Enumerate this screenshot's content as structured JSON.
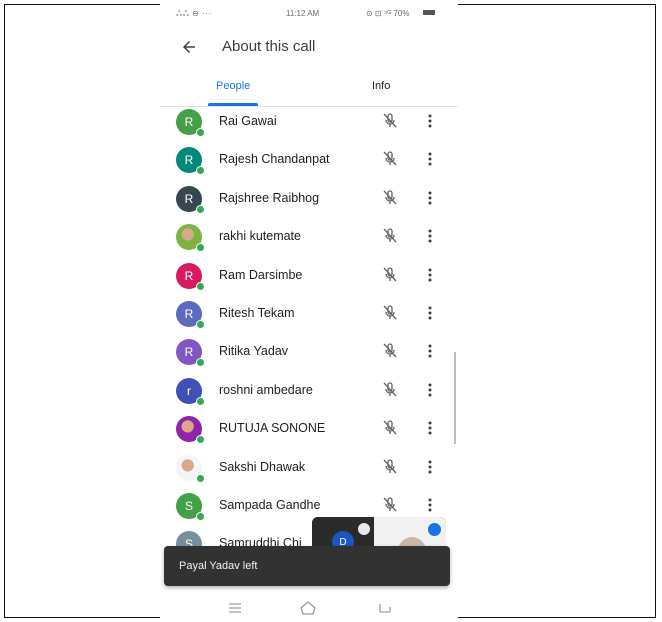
{
  "status_bar": {
    "left_icons": "ஃஃ ⊖ ···",
    "time": "11:12 AM",
    "right_icons": "⊙ ⊡ ⁴ᴳ 70%"
  },
  "appbar": {
    "title": "About this call",
    "back_icon": "arrow-back-icon"
  },
  "tabs": [
    {
      "label": "People",
      "selected": true
    },
    {
      "label": "Info",
      "selected": false
    }
  ],
  "participants": [
    {
      "name": "Rai Gawai",
      "initial": "R",
      "color": "#43a047"
    },
    {
      "name": "Rajesh Chandanpat",
      "initial": "R",
      "color": "#00897b"
    },
    {
      "name": "Rajshree Raibhog",
      "initial": "R",
      "color": "#37474f"
    },
    {
      "name": "rakhi kutemate",
      "initial": "",
      "color": "#7cb342",
      "photo": true
    },
    {
      "name": "Ram Darsimbe",
      "initial": "R",
      "color": "#d81b60"
    },
    {
      "name": "Ritesh Tekam",
      "initial": "R",
      "color": "#5c6bc0"
    },
    {
      "name": "Ritika Yadav",
      "initial": "R",
      "color": "#7e57c2"
    },
    {
      "name": "roshni ambedare",
      "initial": "r",
      "color": "#3f51b5"
    },
    {
      "name": "RUTUJA SONONE",
      "initial": "",
      "color": "#8e24aa",
      "photo": true
    },
    {
      "name": "Sakshi Dhawak",
      "initial": "",
      "color": "#f5f5f5",
      "photo": true
    },
    {
      "name": "Sampada Gandhe",
      "initial": "S",
      "color": "#43a047"
    },
    {
      "name": "Samruddhi Chi",
      "initial": "S",
      "color": "#78909c"
    }
  ],
  "pip": {
    "self_initial": "D"
  },
  "snackbar": {
    "text": "Payal Yadav left"
  },
  "colors": {
    "accent": "#1a73e8",
    "online": "#34a853"
  }
}
